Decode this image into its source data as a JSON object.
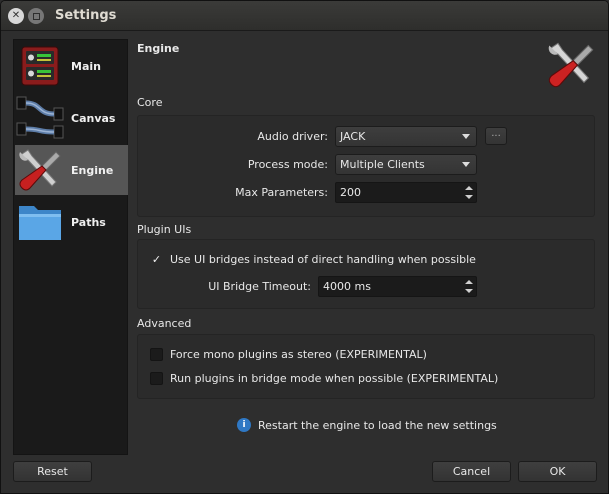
{
  "window": {
    "title": "Settings"
  },
  "sidebar": {
    "items": [
      {
        "label": "Main",
        "icon": "mixer-icon",
        "active": false
      },
      {
        "label": "Canvas",
        "icon": "canvas-connections-icon",
        "active": false
      },
      {
        "label": "Engine",
        "icon": "wrench-screwdriver-icon",
        "active": true
      },
      {
        "label": "Paths",
        "icon": "folder-icon",
        "active": false
      }
    ]
  },
  "page": {
    "title": "Engine",
    "icon": "wrench-screwdriver-icon",
    "core": {
      "label": "Core",
      "audio_driver_label": "Audio driver:",
      "audio_driver_value": "JACK",
      "driver_options_button": "...",
      "process_mode_label": "Process mode:",
      "process_mode_value": "Multiple Clients",
      "max_params_label": "Max Parameters:",
      "max_params_value": "200"
    },
    "plugin_uis": {
      "label": "Plugin UIs",
      "use_bridges_label": "Use UI bridges instead of direct handling when possible",
      "use_bridges_checked": true,
      "bridge_timeout_label": "UI Bridge Timeout:",
      "bridge_timeout_value": "4000 ms"
    },
    "advanced": {
      "label": "Advanced",
      "force_mono_label": "Force mono plugins as stereo (EXPERIMENTAL)",
      "force_mono_checked": false,
      "bridge_mode_label": "Run plugins in bridge mode when possible (EXPERIMENTAL)",
      "bridge_mode_checked": false
    },
    "restart_notice": "Restart the engine to load the new settings"
  },
  "buttons": {
    "reset": "Reset",
    "cancel": "Cancel",
    "ok": "OK"
  },
  "colors": {
    "active_item": "#565656",
    "accent_info": "#2f78c4",
    "window_bg": "#2e2e2e"
  }
}
